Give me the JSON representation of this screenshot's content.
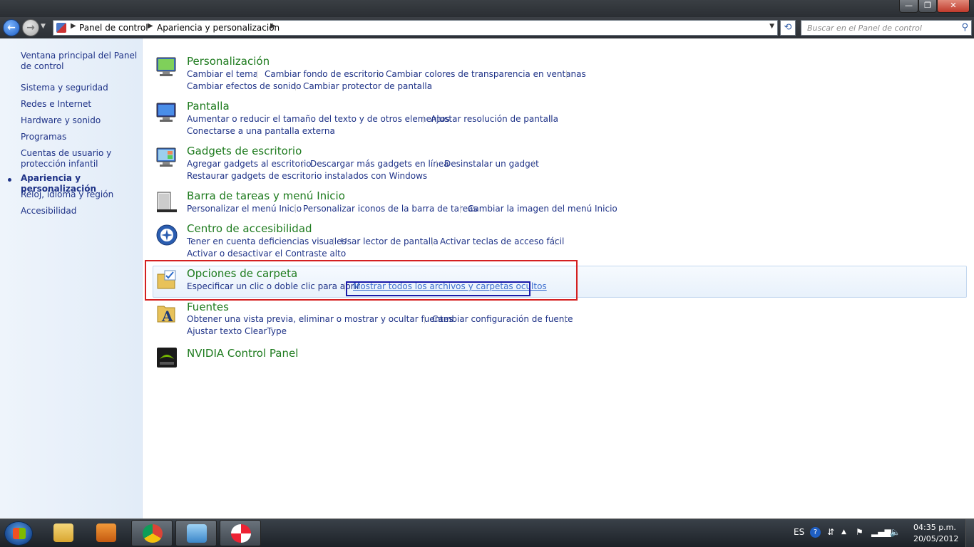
{
  "window": {
    "min_glyph": "—",
    "max_glyph": "❐",
    "close_glyph": "✕"
  },
  "nav": {
    "back_glyph": "←",
    "forward_glyph": "→",
    "breadcrumb": [
      "Panel de control",
      "Apariencia y personalización"
    ],
    "search_placeholder": "Buscar en el Panel de control"
  },
  "sidebar": {
    "items": [
      {
        "label": "Ventana principal del Panel de control"
      },
      {
        "label": "Sistema y seguridad"
      },
      {
        "label": "Redes e Internet"
      },
      {
        "label": "Hardware y sonido"
      },
      {
        "label": "Programas"
      },
      {
        "label": "Cuentas de usuario y protección infantil"
      },
      {
        "label": "Apariencia y personalización",
        "active": true
      },
      {
        "label": "Reloj, idioma y región"
      },
      {
        "label": "Accesibilidad"
      }
    ]
  },
  "categories": [
    {
      "title": "Personalización",
      "icon": "personalization-icon",
      "links": [
        "Cambiar el tema",
        "Cambiar fondo de escritorio",
        "Cambiar colores de transparencia en ventanas",
        "Cambiar efectos de sonido",
        "Cambiar protector de pantalla"
      ]
    },
    {
      "title": "Pantalla",
      "icon": "display-icon",
      "links": [
        "Aumentar o reducir el tamaño del texto y de otros elementos",
        "Ajustar resolución de pantalla",
        "Conectarse a una pantalla externa"
      ]
    },
    {
      "title": "Gadgets de escritorio",
      "icon": "gadgets-icon",
      "links": [
        "Agregar gadgets al escritorio",
        "Descargar más gadgets en línea",
        "Desinstalar un gadget",
        "Restaurar gadgets de escritorio instalados con Windows"
      ]
    },
    {
      "title": "Barra de tareas y menú Inicio",
      "icon": "taskbar-icon",
      "links": [
        "Personalizar el menú Inicio",
        "Personalizar iconos de la barra de tareas",
        "Cambiar la imagen del menú Inicio"
      ]
    },
    {
      "title": "Centro de accesibilidad",
      "icon": "accessibility-icon",
      "links": [
        "Tener en cuenta deficiencias visuales",
        "Usar lector de pantalla",
        "Activar teclas de acceso fácil",
        "Activar o desactivar el Contraste alto"
      ]
    },
    {
      "title": "Opciones de carpeta",
      "icon": "folder-options-icon",
      "links": [
        "Especificar un clic o doble clic para abrir",
        "Mostrar todos los archivos y carpetas ocultos"
      ]
    },
    {
      "title": "Fuentes",
      "icon": "fonts-icon",
      "links": [
        "Obtener una vista previa, eliminar o mostrar y ocultar fuentes",
        "Cambiar configuración de fuente",
        "Ajustar texto ClearType"
      ]
    },
    {
      "title": "NVIDIA Control Panel",
      "icon": "nvidia-icon",
      "links": []
    }
  ],
  "taskbar": {
    "apps": [
      "explorer-icon",
      "media-player-icon",
      "chrome-icon",
      "control-panel-icon",
      "app-icon"
    ],
    "language": "ES",
    "time": "04:35 p.m.",
    "date": "20/05/2012"
  },
  "colors": {
    "title_green": "#1e7b1e",
    "link_blue": "#1e3287",
    "highlight_red": "#d42020",
    "highlight_blue": "#1a1aa8"
  }
}
